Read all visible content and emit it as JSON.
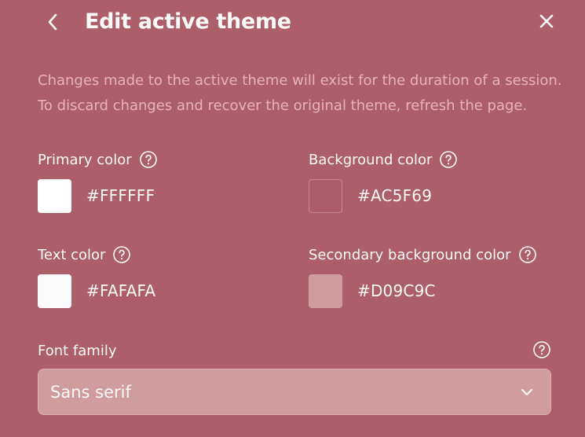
{
  "dialog": {
    "title": "Edit active theme",
    "description": [
      "Changes made to the active theme will exist for the duration of a session.",
      "To discard changes and recover the original theme, refresh the page."
    ]
  },
  "fields": {
    "primary": {
      "label": "Primary color",
      "value": "#FFFFFF",
      "swatch": "#FFFFFF"
    },
    "background": {
      "label": "Background color",
      "value": "#AC5F69",
      "swatch": "#AC5F69"
    },
    "text": {
      "label": "Text color",
      "value": "#FAFAFA",
      "swatch": "#FAFAFA"
    },
    "secondary": {
      "label": "Secondary background color",
      "value": "#D09C9C",
      "swatch": "#D09C9C"
    }
  },
  "font": {
    "label": "Font family",
    "selected": "Sans serif"
  },
  "icons": {
    "back": "chevron-left-icon",
    "close": "close-icon",
    "help": "help-circle-icon",
    "dropdown": "chevron-down-icon"
  }
}
